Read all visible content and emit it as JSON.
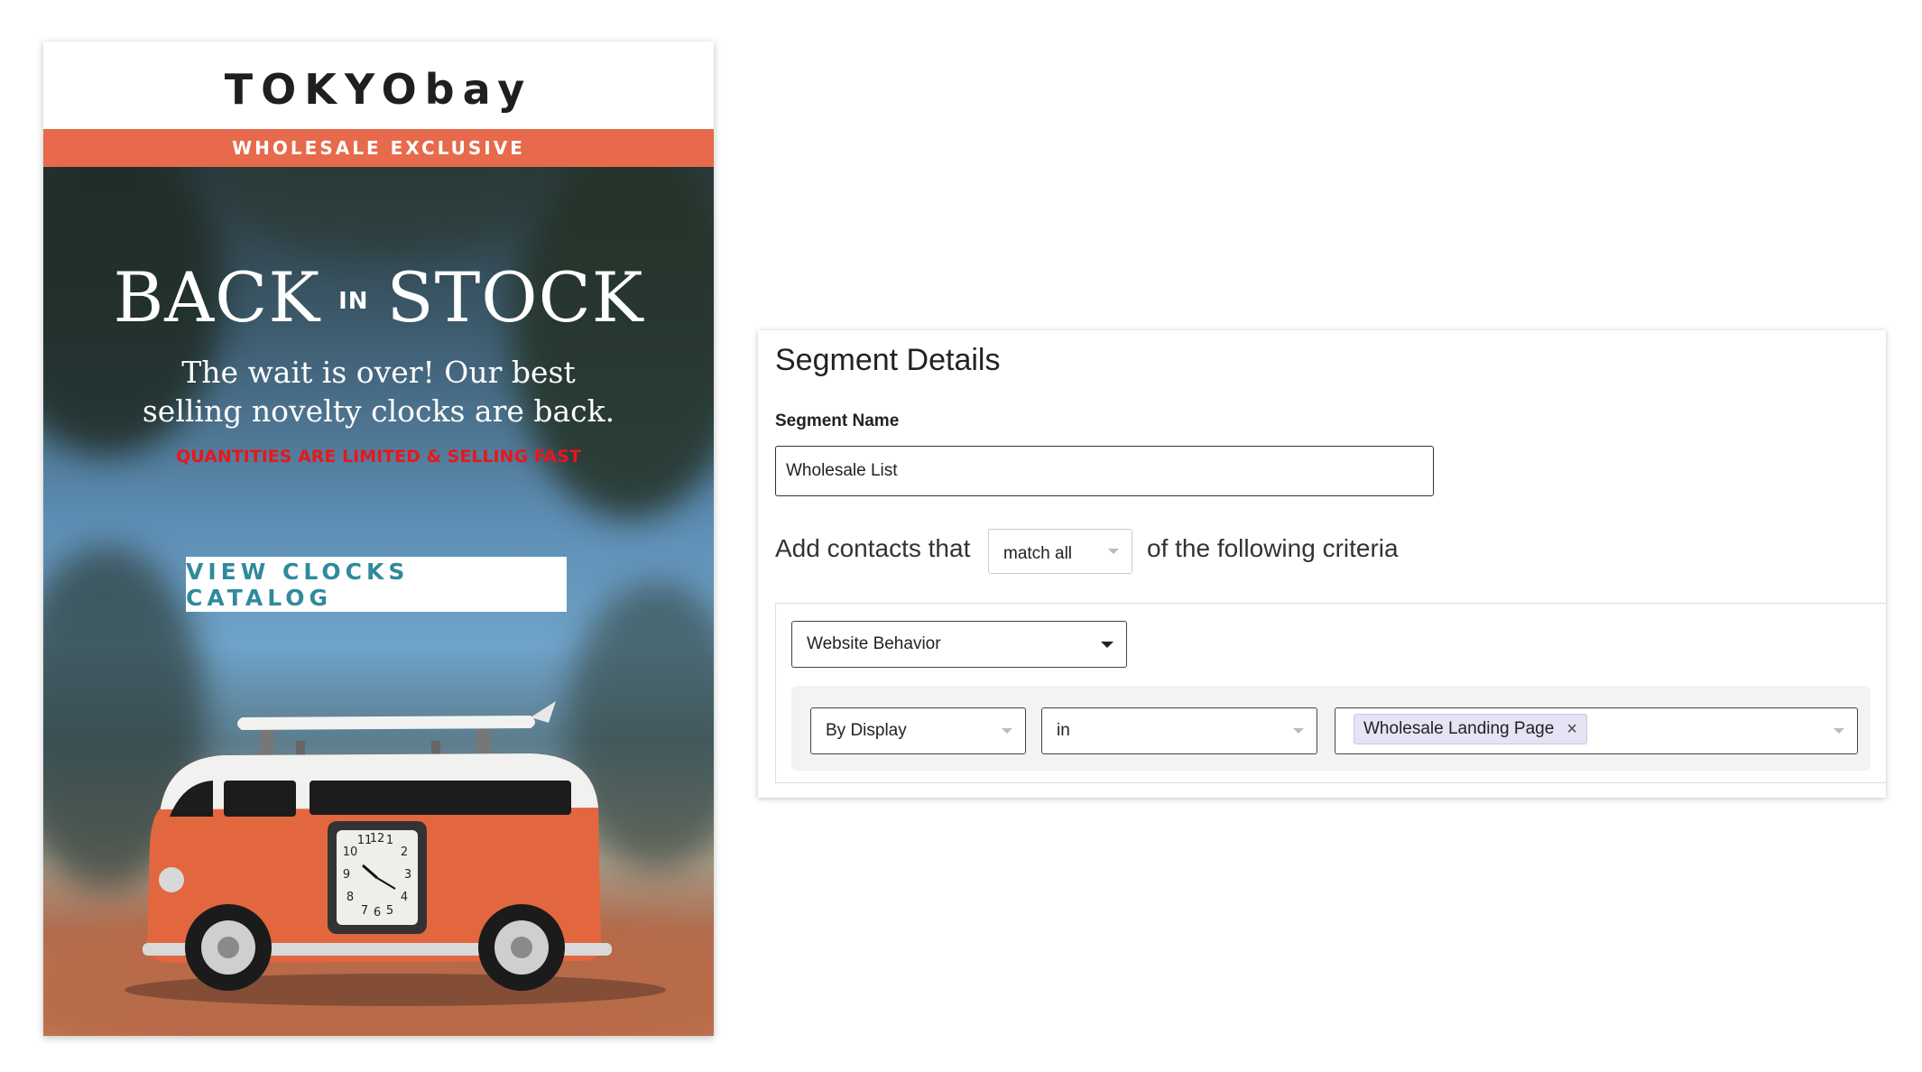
{
  "email": {
    "logo": "TOKYObay",
    "banner": "WHOLESALE EXCLUSIVE",
    "headline_left": "BACK",
    "headline_mid": "IN",
    "headline_right": "STOCK",
    "subhead_line1": "The wait is over! Our best",
    "subhead_line2": "selling novelty clocks are back.",
    "alert": "QUANTITIES ARE LIMITED & SELLING FAST",
    "cta": "VIEW CLOCKS CATALOG",
    "clock_numbers": [
      "11",
      "12",
      "1",
      "10",
      "2",
      "9",
      "3",
      "8",
      "4",
      "7",
      "6",
      "5"
    ],
    "colors": {
      "banner": "#e66a4b",
      "cta_text": "#2f8a9c",
      "alert": "#e8171b",
      "van": "#e2673f"
    }
  },
  "segment": {
    "title": "Segment Details",
    "name_label": "Segment Name",
    "name_value": "Wholesale List",
    "criteria_lead": "Add contacts that",
    "match_value": "match all",
    "criteria_tail": "of the following criteria",
    "category_value": "Website Behavior",
    "condition_field": "By Display",
    "condition_operator": "in",
    "condition_value_chip": "Wholesale Landing Page",
    "chip_remove": "×"
  }
}
